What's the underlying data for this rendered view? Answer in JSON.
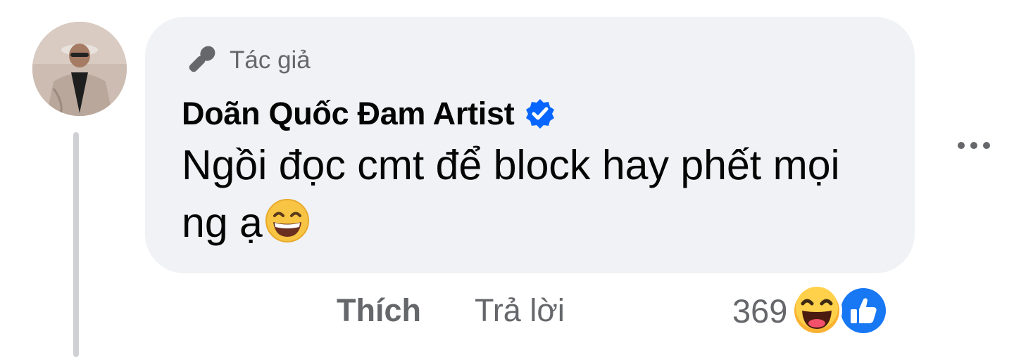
{
  "comment": {
    "author_badge": "Tác giả",
    "author_badge_icon": "microphone-icon",
    "author_name": "Doãn Quốc Đam Artist",
    "verified_icon": "verified-badge-icon",
    "text": "Ngồi đọc cmt để block hay phết mọi ng ạ",
    "inline_emoji": "grinning-squinting-face-emoji"
  },
  "actions": {
    "like_label": "Thích",
    "reply_label": "Trả lời"
  },
  "reactions": {
    "count": "369",
    "icons": [
      "haha-reaction-icon",
      "like-reaction-icon"
    ]
  },
  "colors": {
    "bubble_bg": "#f0f2f5",
    "secondary_text": "#65676b",
    "verified_blue": "#0866ff",
    "like_blue": "#1877f2"
  }
}
